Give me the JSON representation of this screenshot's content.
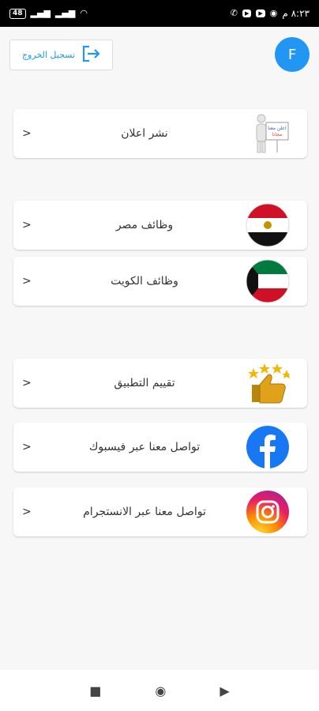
{
  "status_bar": {
    "battery": "48",
    "time": "٨:٢٣ م"
  },
  "header": {
    "logout_label": "تسجيل الخروج",
    "avatar_initial": "F"
  },
  "cards": [
    {
      "label": "نشر اعلان",
      "chevron": ">",
      "icon": "advertise-free-sign-icon",
      "icon_text": "اعلن معنا مجانا"
    },
    {
      "label": "وظائف مصر",
      "chevron": ">",
      "icon": "egypt-flag-icon"
    },
    {
      "label": "وظائف الكويت",
      "chevron": ">",
      "icon": "kuwait-flag-icon"
    },
    {
      "label": "تقييم التطبيق",
      "chevron": ">",
      "icon": "thumbs-up-stars-icon"
    },
    {
      "label": "تواصل معنا عبر فيسبوك",
      "chevron": ">",
      "icon": "facebook-icon"
    },
    {
      "label": "تواصل معنا عبر الانستجرام",
      "chevron": ">",
      "icon": "instagram-icon"
    }
  ],
  "colors": {
    "accent": "#2196f3",
    "background": "#f7f7f7"
  }
}
